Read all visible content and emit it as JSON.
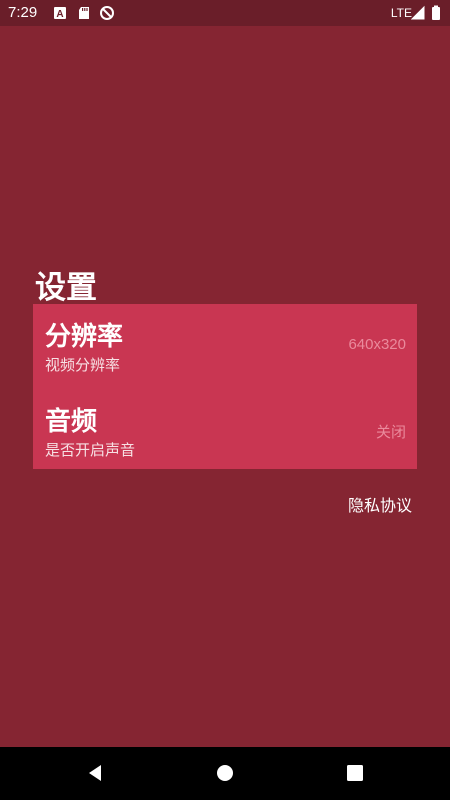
{
  "status_bar": {
    "time": "7:29",
    "network": "LTE",
    "icons": [
      "a-icon",
      "sd-card-icon",
      "no-sync-icon",
      "signal-icon",
      "battery-icon"
    ]
  },
  "page": {
    "title": "设置"
  },
  "settings": [
    {
      "title": "分辨率",
      "subtitle": "视频分辨率",
      "value": "640x320"
    },
    {
      "title": "音频",
      "subtitle": "是否开启声音",
      "value": "关闭"
    }
  ],
  "footer": {
    "privacy_link": "隐私协议"
  },
  "colors": {
    "background": "#852532",
    "status_bar": "#6a1e29",
    "card": "#c93652",
    "value_text": "#ea8a9c"
  },
  "nav": {
    "icons": [
      "back-icon",
      "home-icon",
      "recents-icon"
    ]
  }
}
